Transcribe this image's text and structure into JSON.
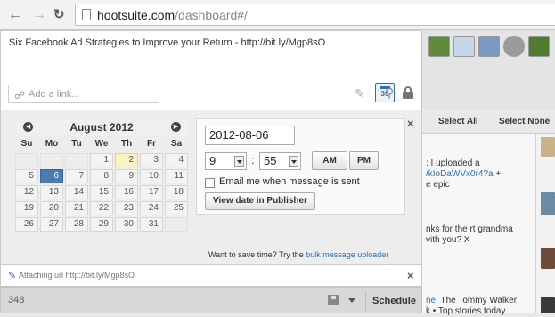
{
  "browser": {
    "url_host": "hootsuite.com",
    "url_path": "/dashboard#/"
  },
  "composer": {
    "message": "Six Facebook Ad Strategies to Improve your Return - http://bit.ly/Mgp8sO",
    "link_placeholder": "Add a link...",
    "calendar_day": "30"
  },
  "schedule": {
    "month_label": "August 2012",
    "daynames": [
      "Su",
      "Mo",
      "Tu",
      "We",
      "Th",
      "Fr",
      "Sa"
    ],
    "weeks": [
      [
        "",
        "",
        "",
        "1",
        "2",
        "3",
        "4"
      ],
      [
        "5",
        "6",
        "7",
        "8",
        "9",
        "10",
        "11"
      ],
      [
        "12",
        "13",
        "14",
        "15",
        "16",
        "17",
        "18"
      ],
      [
        "19",
        "20",
        "21",
        "22",
        "23",
        "24",
        "25"
      ],
      [
        "26",
        "27",
        "28",
        "29",
        "30",
        "31",
        ""
      ]
    ],
    "selected_day": "6",
    "today_day": "2",
    "date_value": "2012-08-06",
    "hour": "9",
    "minute": "55",
    "am_label": "AM",
    "pm_label": "PM",
    "email_label": "Email me when message is sent",
    "view_date_label": "View date in Publisher",
    "hint_prefix": "Want to save time? Try the ",
    "hint_link": "bulk message uploader",
    "close_label": "×"
  },
  "attachment": {
    "text": "Attaching url http://bit.ly/Mgp8sO",
    "close_label": "×"
  },
  "bottom_bar": {
    "char_count": "348",
    "schedule_label": "Schedule"
  },
  "stream": {
    "select_all": "Select All",
    "select_none": "Select None",
    "snippet_1_line_1": ": I uploaded a",
    "snippet_1_line_2_link": "/kIoDaWVx0r4?a",
    "snippet_1_line_2_suffix": " +",
    "snippet_1_line_3": "e epic",
    "snippet_2_line_1": "nks for the rt grandma",
    "snippet_2_line_2": "vith you? X",
    "snippet_3_line_1_link": "ne",
    "snippet_3_line_1_suffix": ": The Tommy Walker",
    "snippet_3_line_2": "k • Top stories today"
  },
  "colors": {
    "accent": "#2a6ebb",
    "selected_day": "#4c7bb4",
    "today_day": "#fbf3c4"
  }
}
